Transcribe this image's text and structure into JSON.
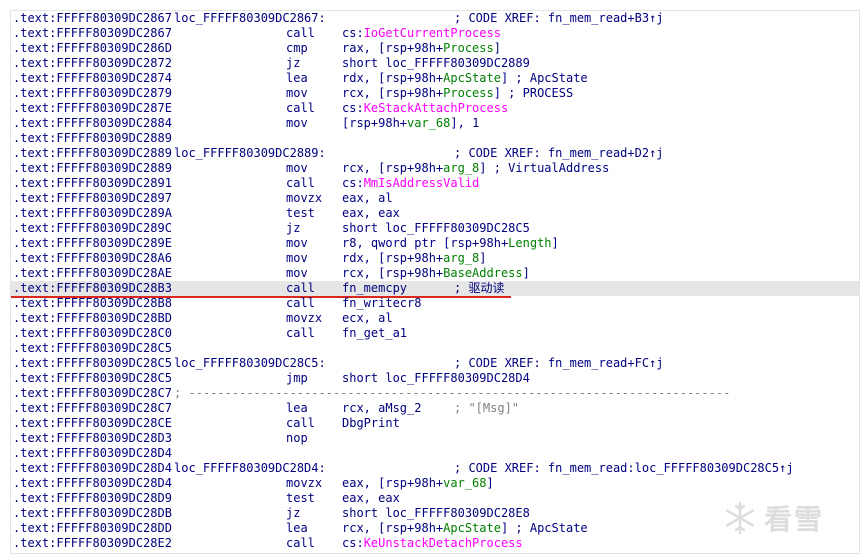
{
  "lines": [
    {
      "addr": ".text:FFFFF80309DC2867",
      "label": "loc_FFFFF80309DC2867:",
      "comment": "; CODE XREF: fn_mem_read+B3↑j"
    },
    {
      "addr": ".text:FFFFF80309DC2867",
      "mn": "call",
      "op": [
        {
          "t": "cs:",
          "c": "n"
        },
        {
          "t": "IoGetCurrentProcess",
          "c": "f"
        }
      ]
    },
    {
      "addr": ".text:FFFFF80309DC286D",
      "mn": "cmp",
      "op": [
        {
          "t": "rax, [rsp+98h+",
          "c": "n"
        },
        {
          "t": "Process",
          "c": "v"
        },
        {
          "t": "]",
          "c": "n"
        }
      ]
    },
    {
      "addr": ".text:FFFFF80309DC2872",
      "mn": "jz",
      "op": [
        {
          "t": "short loc_FFFFF80309DC2889",
          "c": "n"
        }
      ]
    },
    {
      "addr": ".text:FFFFF80309DC2874",
      "mn": "lea",
      "op": [
        {
          "t": "rdx, [rsp+98h+",
          "c": "n"
        },
        {
          "t": "ApcState",
          "c": "v"
        },
        {
          "t": "] ; ApcState",
          "c": "n"
        }
      ]
    },
    {
      "addr": ".text:FFFFF80309DC2879",
      "mn": "mov",
      "op": [
        {
          "t": "rcx, [rsp+98h+",
          "c": "n"
        },
        {
          "t": "Process",
          "c": "v"
        },
        {
          "t": "] ; PROCESS",
          "c": "n"
        }
      ]
    },
    {
      "addr": ".text:FFFFF80309DC287E",
      "mn": "call",
      "op": [
        {
          "t": "cs:",
          "c": "n"
        },
        {
          "t": "KeStackAttachProcess",
          "c": "f"
        }
      ]
    },
    {
      "addr": ".text:FFFFF80309DC2884",
      "mn": "mov",
      "op": [
        {
          "t": "[rsp+98h+",
          "c": "n"
        },
        {
          "t": "var_68",
          "c": "v"
        },
        {
          "t": "], 1",
          "c": "n"
        }
      ]
    },
    {
      "addr": ".text:FFFFF80309DC2889"
    },
    {
      "addr": ".text:FFFFF80309DC2889",
      "label": "loc_FFFFF80309DC2889:",
      "comment": "; CODE XREF: fn_mem_read+D2↑j"
    },
    {
      "addr": ".text:FFFFF80309DC2889",
      "mn": "mov",
      "op": [
        {
          "t": "rcx, [rsp+98h+",
          "c": "n"
        },
        {
          "t": "arg_8",
          "c": "v"
        },
        {
          "t": "] ; VirtualAddress",
          "c": "n"
        }
      ]
    },
    {
      "addr": ".text:FFFFF80309DC2891",
      "mn": "call",
      "op": [
        {
          "t": "cs:",
          "c": "n"
        },
        {
          "t": "MmIsAddressValid",
          "c": "f"
        }
      ]
    },
    {
      "addr": ".text:FFFFF80309DC2897",
      "mn": "movzx",
      "op": [
        {
          "t": "eax, al",
          "c": "n"
        }
      ]
    },
    {
      "addr": ".text:FFFFF80309DC289A",
      "mn": "test",
      "op": [
        {
          "t": "eax, eax",
          "c": "n"
        }
      ]
    },
    {
      "addr": ".text:FFFFF80309DC289C",
      "mn": "jz",
      "op": [
        {
          "t": "short loc_FFFFF80309DC28C5",
          "c": "n"
        }
      ]
    },
    {
      "addr": ".text:FFFFF80309DC289E",
      "mn": "mov",
      "op": [
        {
          "t": "r8, qword ptr [rsp+98h+",
          "c": "n"
        },
        {
          "t": "Length",
          "c": "v"
        },
        {
          "t": "]",
          "c": "n"
        }
      ]
    },
    {
      "addr": ".text:FFFFF80309DC28A6",
      "mn": "mov",
      "op": [
        {
          "t": "rdx, [rsp+98h+",
          "c": "n"
        },
        {
          "t": "arg_8",
          "c": "v"
        },
        {
          "t": "]",
          "c": "n"
        }
      ]
    },
    {
      "addr": ".text:FFFFF80309DC28AE",
      "mn": "mov",
      "op": [
        {
          "t": "rcx, [rsp+98h+",
          "c": "n"
        },
        {
          "t": "BaseAddress",
          "c": "v"
        },
        {
          "t": "]",
          "c": "n"
        }
      ]
    },
    {
      "addr": ".text:FFFFF80309DC28B3",
      "mn": "call",
      "op": [
        {
          "t": "fn_memcpy",
          "c": "n"
        }
      ],
      "comment": "; 驱动读",
      "highlight": true
    },
    {
      "addr": ".text:FFFFF80309DC28B8",
      "mn": "call",
      "op": [
        {
          "t": "fn_writecr8",
          "c": "n"
        }
      ]
    },
    {
      "addr": ".text:FFFFF80309DC28BD",
      "mn": "movzx",
      "op": [
        {
          "t": "ecx, al",
          "c": "n"
        }
      ]
    },
    {
      "addr": ".text:FFFFF80309DC28C0",
      "mn": "call",
      "op": [
        {
          "t": "fn_get_a1",
          "c": "n"
        }
      ]
    },
    {
      "addr": ".text:FFFFF80309DC28C5"
    },
    {
      "addr": ".text:FFFFF80309DC28C5",
      "label": "loc_FFFFF80309DC28C5:",
      "comment": "; CODE XREF: fn_mem_read+FC↑j"
    },
    {
      "addr": ".text:FFFFF80309DC28C5",
      "mn": "jmp",
      "op": [
        {
          "t": "short loc_FFFFF80309DC28D4",
          "c": "n"
        }
      ]
    },
    {
      "addr": ".text:FFFFF80309DC28C7",
      "separator": "; ---------------------------------------------------------------------------"
    },
    {
      "addr": ".text:FFFFF80309DC28C7",
      "mn": "lea",
      "op": [
        {
          "t": "rcx, aMsg_2",
          "c": "n"
        }
      ],
      "comment": "; \"[Msg]\"",
      "comment_gray": true
    },
    {
      "addr": ".text:FFFFF80309DC28CE",
      "mn": "call",
      "op": [
        {
          "t": "DbgPrint",
          "c": "n"
        }
      ]
    },
    {
      "addr": ".text:FFFFF80309DC28D3",
      "mn": "nop"
    },
    {
      "addr": ".text:FFFFF80309DC28D4"
    },
    {
      "addr": ".text:FFFFF80309DC28D4",
      "label": "loc_FFFFF80309DC28D4:",
      "comment": "; CODE XREF: fn_mem_read:loc_FFFFF80309DC28C5↑j"
    },
    {
      "addr": ".text:FFFFF80309DC28D4",
      "mn": "movzx",
      "op": [
        {
          "t": "eax, [rsp+98h+",
          "c": "n"
        },
        {
          "t": "var_68",
          "c": "v"
        },
        {
          "t": "]",
          "c": "n"
        }
      ]
    },
    {
      "addr": ".text:FFFFF80309DC28D9",
      "mn": "test",
      "op": [
        {
          "t": "eax, eax",
          "c": "n"
        }
      ]
    },
    {
      "addr": ".text:FFFFF80309DC28DB",
      "mn": "jz",
      "op": [
        {
          "t": "short loc_FFFFF80309DC28E8",
          "c": "n"
        }
      ]
    },
    {
      "addr": ".text:FFFFF80309DC28DD",
      "mn": "lea",
      "op": [
        {
          "t": "rcx, [rsp+98h+",
          "c": "n"
        },
        {
          "t": "ApcState",
          "c": "v"
        },
        {
          "t": "] ; ApcState",
          "c": "n"
        }
      ]
    },
    {
      "addr": ".text:FFFFF80309DC28E2",
      "mn": "call",
      "op": [
        {
          "t": "cs:",
          "c": "n"
        },
        {
          "t": "KeUnstackDetachProcess",
          "c": "f"
        }
      ]
    }
  ],
  "watermark": {
    "text": "看雪",
    "icon": "snowflake-icon"
  },
  "colors": {
    "code": "#000080",
    "stack_var": "#008000",
    "import": "#ff00ff",
    "comment_gray": "#808080",
    "highlight_box": "#d9281e"
  }
}
